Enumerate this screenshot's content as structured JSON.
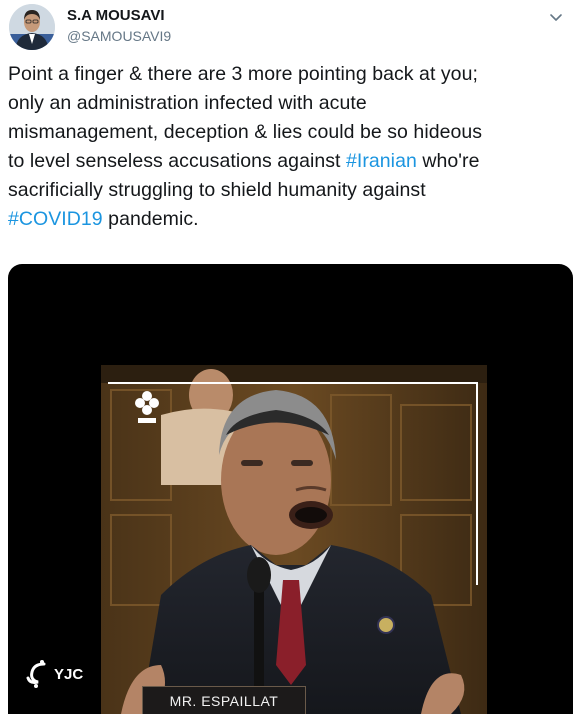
{
  "user": {
    "display_name": "S.A MOUSAVI",
    "handle": "@SAMOUSAVI9"
  },
  "tweet": {
    "lines": [
      [
        {
          "text": "Point a finger & there are 3 more pointing back at you;"
        }
      ],
      [
        {
          "text": "only an administration infected with acute"
        }
      ],
      [
        {
          "text": "mismanagement, deception & lies could be so hideous"
        }
      ],
      [
        {
          "text": "to level senseless accusations against "
        },
        {
          "text": "#Iranian",
          "hashtag": true
        },
        {
          "text": " who're"
        }
      ],
      [
        {
          "text": "sacrificially struggling to shield humanity against"
        }
      ],
      [
        {
          "text": "#COVID19",
          "hashtag": true
        },
        {
          "text": " pandemic."
        }
      ]
    ]
  },
  "media": {
    "watermark": "YJC",
    "nameplate": "MR. ESPAILLAT"
  },
  "colors": {
    "hashtag": "#1b95e0",
    "handle": "#657786",
    "media_bg": "#000000"
  },
  "icons": [
    "avatar",
    "chevron-down-icon",
    "station-logo-icon",
    "yjc-logo-icon",
    "microphone-icon",
    "flag-pin-icon"
  ]
}
